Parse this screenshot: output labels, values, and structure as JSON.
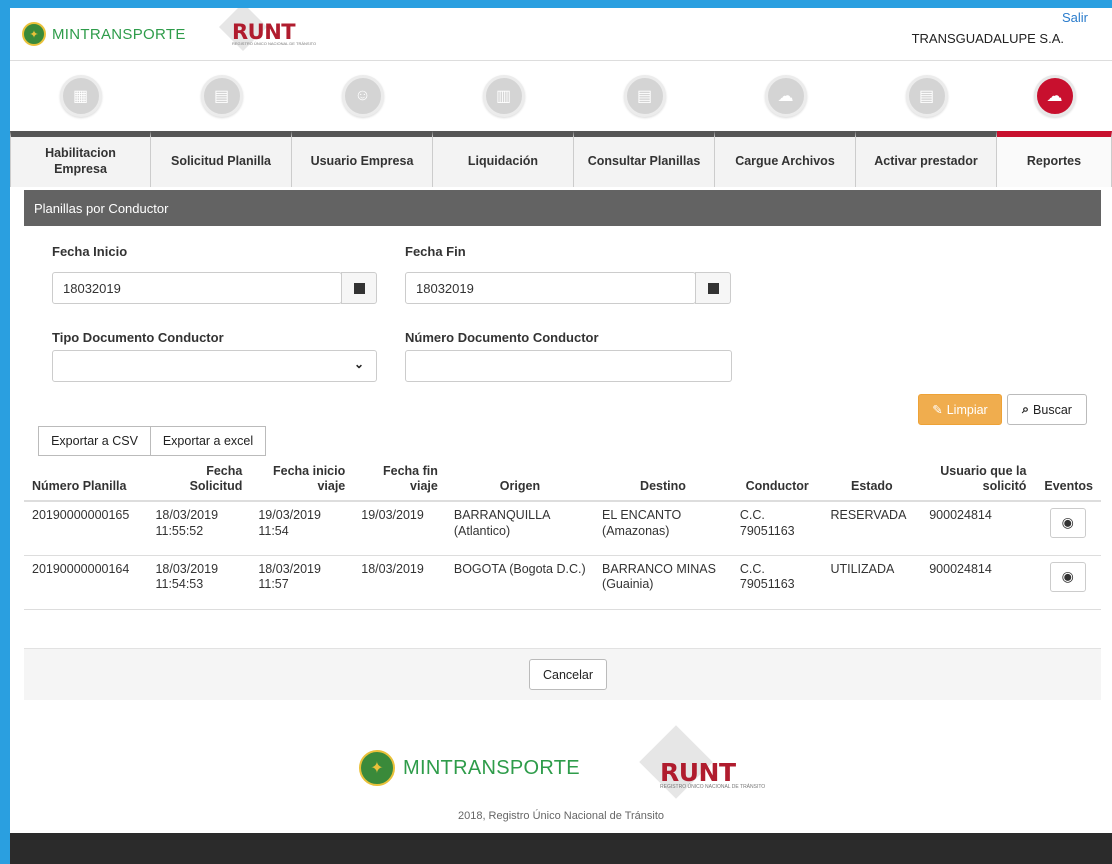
{
  "header": {
    "brand": "MINTRANSPORTE",
    "runt": "RUNT",
    "runt_sub": "REGISTRO ÚNICO NACIONAL DE TRÁNSITO",
    "logout": "Salir",
    "company": "TRANSGUADALUPE S.A."
  },
  "nav": {
    "tabs": [
      {
        "label": "Habilitacion Empresa",
        "icon": "building-icon"
      },
      {
        "label": "Solicitud Planilla",
        "icon": "document-icon"
      },
      {
        "label": "Usuario Empresa",
        "icon": "user-icon"
      },
      {
        "label": "Liquidación",
        "icon": "calculator-icon"
      },
      {
        "label": "Consultar Planillas",
        "icon": "document-search-icon"
      },
      {
        "label": "Cargue Archivos",
        "icon": "cloud-upload-icon"
      },
      {
        "label": "Activar prestador",
        "icon": "document-check-icon"
      },
      {
        "label": "Reportes",
        "icon": "cloud-upload-icon"
      }
    ],
    "active_tab": "Reportes",
    "active_color": "#c8102e"
  },
  "panel": {
    "title": "Planillas por Conductor"
  },
  "form": {
    "fecha_inicio_label": "Fecha Inicio",
    "fecha_inicio_value": "18032019",
    "fecha_fin_label": "Fecha Fin",
    "fecha_fin_value": "18032019",
    "tipo_doc_label": "Tipo Documento Conductor",
    "tipo_doc_value": "",
    "num_doc_label": "Número Documento Conductor",
    "num_doc_value": ""
  },
  "actions": {
    "clear": "Limpiar",
    "search": "Buscar",
    "export_csv": "Exportar a CSV",
    "export_excel": "Exportar a excel",
    "cancel": "Cancelar"
  },
  "table": {
    "headers": [
      "Número Planilla",
      "Fecha Solicitud",
      "Fecha inicio viaje",
      "Fecha fin viaje",
      "Origen",
      "Destino",
      "Conductor",
      "Estado",
      "Usuario que la solicitó",
      "Eventos"
    ],
    "rows": [
      {
        "numero": "20190000000165",
        "fecha_solicitud": "18/03/2019 11:55:52",
        "fecha_inicio": "19/03/2019 11:54",
        "fecha_fin": "19/03/2019",
        "origen": "BARRANQUILLA (Atlantico)",
        "destino": "EL ENCANTO (Amazonas)",
        "conductor": "C.C. 79051163",
        "estado": "RESERVADA",
        "usuario": "900024814"
      },
      {
        "numero": "20190000000164",
        "fecha_solicitud": "18/03/2019 11:54:53",
        "fecha_inicio": "18/03/2019 11:57",
        "fecha_fin": "18/03/2019",
        "origen": "BOGOTA (Bogota D.C.)",
        "destino": "BARRANCO MINAS (Guainia)",
        "conductor": "C.C. 79051163",
        "estado": "UTILIZADA",
        "usuario": "900024814"
      }
    ]
  },
  "footer": {
    "brand": "MINTRANSPORTE",
    "runt": "RUNT",
    "runt_sub": "REGISTRO ÚNICO NACIONAL DE TRÁNSITO",
    "copyright": "2018, Registro Único Nacional de Tránsito"
  }
}
